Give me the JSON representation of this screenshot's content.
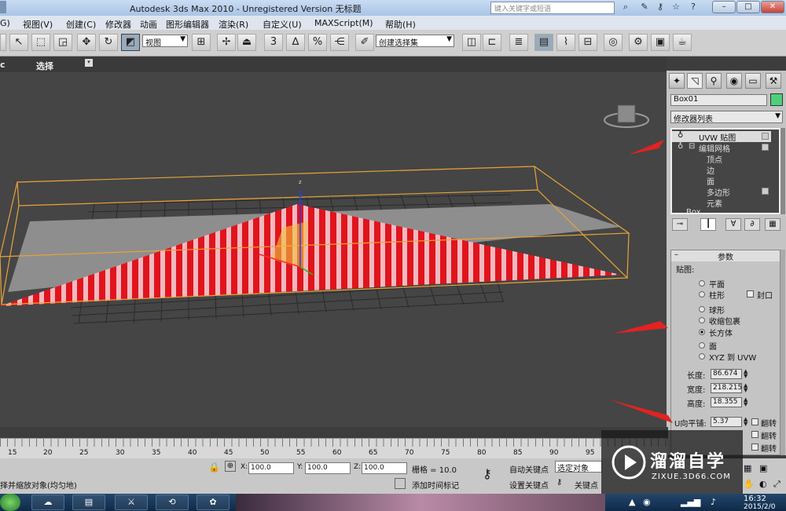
{
  "titlebar": {
    "title": "Autodesk 3ds Max  2010   - Unregistered Version      无标题",
    "help_placeholder": "键入关键字或短语"
  },
  "menu": [
    "G)",
    "视图(V)",
    "创建(C)",
    "修改器",
    "动画",
    "图形编辑器",
    "渲染(R)",
    "自定义(U)",
    "MAXScript(M)",
    "帮助(H)"
  ],
  "toolbar": {
    "view_combo": "视图",
    "selection_set": "创建选择集",
    "snap_3": "3",
    "snap_angle": "∆",
    "snap_pct": "%"
  },
  "viewport_header": {
    "left": "c",
    "select": "选择"
  },
  "command_panel": {
    "object_name": "Box01",
    "modifier_list": "修改器列表",
    "stack": [
      "UVW 贴图",
      "编辑网格",
      "顶点",
      "边",
      "面",
      "多边形",
      "元素",
      "Box"
    ],
    "rollout_title": "参数",
    "mapping_label": "贴图:",
    "mapping_options": [
      "平面",
      "柱形",
      "球形",
      "收缩包裹",
      "长方体",
      "面",
      "XYZ 到 UVW"
    ],
    "cap_label": "封口",
    "selected_mapping": "长方体",
    "length_label": "长度:",
    "length_value": "86.674",
    "width_label": "宽度:",
    "width_value": "218.215",
    "height_label": "高度:",
    "height_value": "18.355",
    "u_tile_label": "U向平铺:",
    "u_tile_value": "5.37",
    "flip_label": "翻转"
  },
  "timeline": {
    "ticks": [
      "15",
      "20",
      "25",
      "30",
      "35",
      "40",
      "45",
      "50",
      "55",
      "60",
      "65",
      "70",
      "75",
      "80",
      "85",
      "90",
      "95"
    ]
  },
  "status": {
    "prompt": "择并缩放对象(均匀地)",
    "x_label": "X:",
    "x_value": "100.0",
    "y_label": "Y:",
    "y_value": "100.0",
    "z_label": "Z:",
    "z_value": "100.0",
    "grid": "栅格 = 10.0",
    "add_time_tag": "添加时间标记",
    "auto_key": "自动关键点",
    "set_key": "设置关键点",
    "selected_object": "选定对象",
    "key_filter": "关键点"
  },
  "watermark": {
    "brand": "溜溜自学",
    "url": "ZIXUE.3D66.COM"
  },
  "taskbar": {
    "time": "16:32",
    "date": "2015/2/0"
  },
  "colors": {
    "stripe_red": "#e0141c",
    "stripe_light": "#f2b8bf",
    "bbox": "#e8a33a",
    "object_color": "#4ed07a"
  }
}
